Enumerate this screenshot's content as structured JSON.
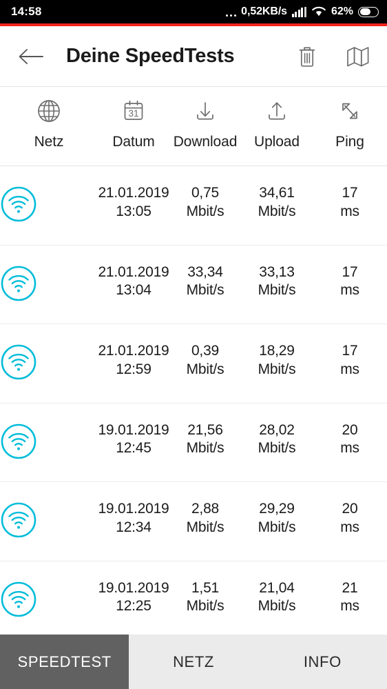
{
  "status_bar": {
    "clock": "14:58",
    "net_speed": "0,52KB/s",
    "battery_percent": "62%",
    "icons": {
      "dots": "more-dots-icon",
      "signal": "cellular-signal-icon",
      "wifi": "wifi-status-icon",
      "battery": "battery-icon"
    },
    "colors": {
      "background": "#000000",
      "foreground": "#ffffff",
      "accent_line": "#f0241e"
    }
  },
  "app_bar": {
    "title": "Deine SpeedTests",
    "back_icon": "back-arrow-icon",
    "delete_icon": "trash-icon",
    "map_icon": "map-icon"
  },
  "table": {
    "columns": [
      {
        "label": "Netz",
        "icon": "globe-icon"
      },
      {
        "label": "Datum",
        "icon": "calendar-31-icon"
      },
      {
        "label": "Download",
        "icon": "download-arrow-icon"
      },
      {
        "label": "Upload",
        "icon": "upload-arrow-icon"
      },
      {
        "label": "Ping",
        "icon": "ping-arrows-icon"
      }
    ],
    "rows": [
      {
        "net_icon": "wifi-circle-icon",
        "date": "21.01.2019",
        "time": "13:05",
        "download_value": "0,75",
        "download_unit": "Mbit/s",
        "upload_value": "34,61",
        "upload_unit": "Mbit/s",
        "ping_value": "17",
        "ping_unit": "ms"
      },
      {
        "net_icon": "wifi-circle-icon",
        "date": "21.01.2019",
        "time": "13:04",
        "download_value": "33,34",
        "download_unit": "Mbit/s",
        "upload_value": "33,13",
        "upload_unit": "Mbit/s",
        "ping_value": "17",
        "ping_unit": "ms"
      },
      {
        "net_icon": "wifi-circle-icon",
        "date": "21.01.2019",
        "time": "12:59",
        "download_value": "0,39",
        "download_unit": "Mbit/s",
        "upload_value": "18,29",
        "upload_unit": "Mbit/s",
        "ping_value": "17",
        "ping_unit": "ms"
      },
      {
        "net_icon": "wifi-circle-icon",
        "date": "19.01.2019",
        "time": "12:45",
        "download_value": "21,56",
        "download_unit": "Mbit/s",
        "upload_value": "28,02",
        "upload_unit": "Mbit/s",
        "ping_value": "20",
        "ping_unit": "ms"
      },
      {
        "net_icon": "wifi-circle-icon",
        "date": "19.01.2019",
        "time": "12:34",
        "download_value": "2,88",
        "download_unit": "Mbit/s",
        "upload_value": "29,29",
        "upload_unit": "Mbit/s",
        "ping_value": "20",
        "ping_unit": "ms"
      },
      {
        "net_icon": "wifi-circle-icon",
        "date": "19.01.2019",
        "time": "12:25",
        "download_value": "1,51",
        "download_unit": "Mbit/s",
        "upload_value": "21,04",
        "upload_unit": "Mbit/s",
        "ping_value": "21",
        "ping_unit": "ms"
      }
    ]
  },
  "bottom_tabs": {
    "items": [
      {
        "label": "SPEEDTEST",
        "active": true
      },
      {
        "label": "NETZ",
        "active": false
      },
      {
        "label": "INFO",
        "active": false
      }
    ],
    "active_background": "#616161",
    "inactive_background": "#ebebeb"
  },
  "colors": {
    "wifi_icon": "#00bcd9",
    "icon_gray": "#707070",
    "text_primary": "#1b1b1b",
    "divider": "#ececec"
  }
}
